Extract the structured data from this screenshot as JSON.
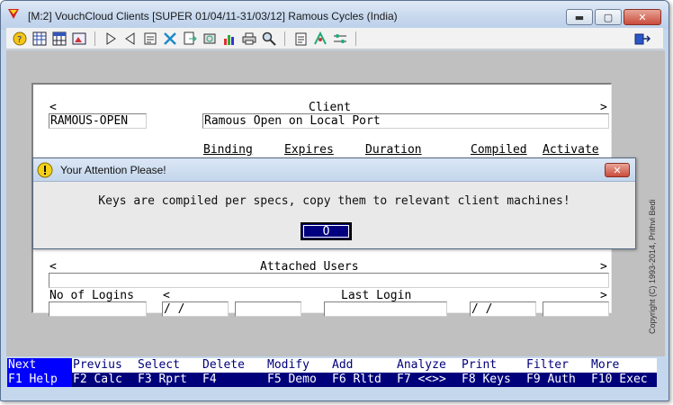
{
  "window": {
    "title": "[M:2]  VouchCloud Clients  [SUPER  01/04/11-31/03/12]  Ramous Cycles (India)",
    "minimize_glyph": "▬",
    "maximize_glyph": "▢",
    "close_glyph": "✕"
  },
  "toolbar": {
    "icons": [
      "help-icon",
      "grid-icon",
      "table-icon",
      "image-icon",
      "play-icon",
      "back-icon",
      "form-icon",
      "tools-icon",
      "export-icon",
      "refresh-icon",
      "chart-icon",
      "print-icon",
      "search-icon",
      "notes-icon",
      "settings-icon",
      "sliders-icon",
      "exit-icon"
    ]
  },
  "form": {
    "prev_marker": "<",
    "next_marker": ">",
    "client_header": "Client",
    "client_code": "RAMOUS-OPEN",
    "client_name": "Ramous Open on Local Port",
    "col_binding": "Binding",
    "col_expires": "Expires",
    "col_duration": "Duration",
    "col_compiled": "Compiled",
    "col_activate": "Activate",
    "attached_users_header": "Attached Users",
    "no_of_logins_label": "No of Logins",
    "last_login_label": "Last Login",
    "date_placeholder": " /  /"
  },
  "dialog": {
    "title": "Your Attention Please!",
    "close_glyph": "✕",
    "message": "Keys are compiled per specs, copy them to relevant client machines!",
    "ok_label": "O"
  },
  "copyright": "Copyright (C) 1993-2014, Prithvi Bedi",
  "function_keys": [
    {
      "action": "Next",
      "key": "F1 Help"
    },
    {
      "action": "Previus",
      "key": "F2 Calc"
    },
    {
      "action": "Select",
      "key": "F3 Rprt"
    },
    {
      "action": "Delete",
      "key": "F4"
    },
    {
      "action": "Modify",
      "key": "F5 Demo"
    },
    {
      "action": "Add",
      "key": "F6 Rltd"
    },
    {
      "action": "Analyze",
      "key": "F7 <<>>"
    },
    {
      "action": "Print",
      "key": "F8 Keys"
    },
    {
      "action": "Filter",
      "key": "F9 Auth"
    },
    {
      "action": "More",
      "key": "F10 Exec"
    }
  ]
}
